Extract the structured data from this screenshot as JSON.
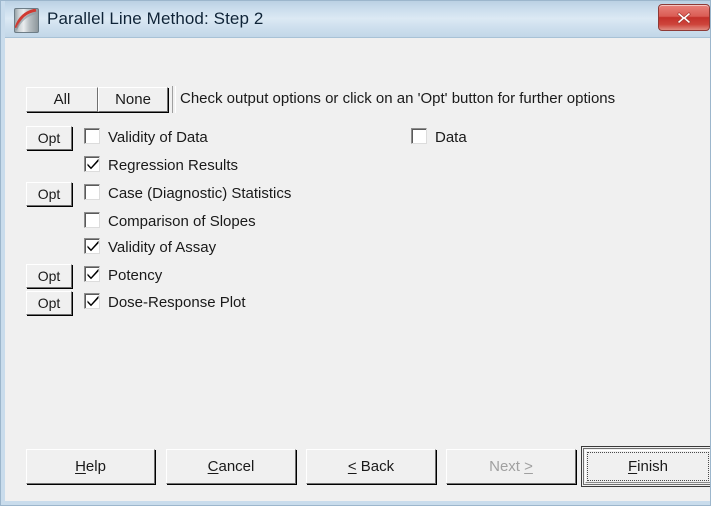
{
  "window": {
    "title": "Parallel Line Method: Step 2",
    "icon": "curve-chart-icon",
    "close_label": "Close",
    "close_icon": "close-icon"
  },
  "toolbar": {
    "all_label": "All",
    "none_label": "None",
    "hint": "Check output options or click on an 'Opt' button for further options"
  },
  "options": {
    "opt_label": "Opt",
    "left_column": [
      {
        "label": "Validity of Data",
        "checked": false,
        "has_opt": true
      },
      {
        "label": "Regression Results",
        "checked": true,
        "has_opt": false
      },
      {
        "label": "Case (Diagnostic) Statistics",
        "checked": false,
        "has_opt": true
      },
      {
        "label": "Comparison of Slopes",
        "checked": false,
        "has_opt": false
      },
      {
        "label": "Validity of Assay",
        "checked": true,
        "has_opt": false
      },
      {
        "label": "Potency",
        "checked": true,
        "has_opt": true
      },
      {
        "label": "Dose-Response Plot",
        "checked": true,
        "has_opt": true
      }
    ],
    "right_column": [
      {
        "label": "Data",
        "checked": false,
        "has_opt": false
      }
    ]
  },
  "footer": {
    "buttons": [
      {
        "label": "Help",
        "accel": "H",
        "disabled": false,
        "default": false
      },
      {
        "label": "Cancel",
        "accel": "C",
        "disabled": false,
        "default": false
      },
      {
        "label": "< Back",
        "accel": "<",
        "disabled": false,
        "default": false
      },
      {
        "label": "Next >",
        "accel": ">",
        "disabled": true,
        "default": false
      },
      {
        "label": "Finish",
        "accel": "F",
        "disabled": false,
        "default": true
      }
    ]
  },
  "colors": {
    "dialog_face": "#f0f0f0",
    "titlebar_blue": "#c9dcec",
    "close_red": "#c3302a",
    "text": "#1a1a1a",
    "disabled_text": "#a0a0a0"
  }
}
